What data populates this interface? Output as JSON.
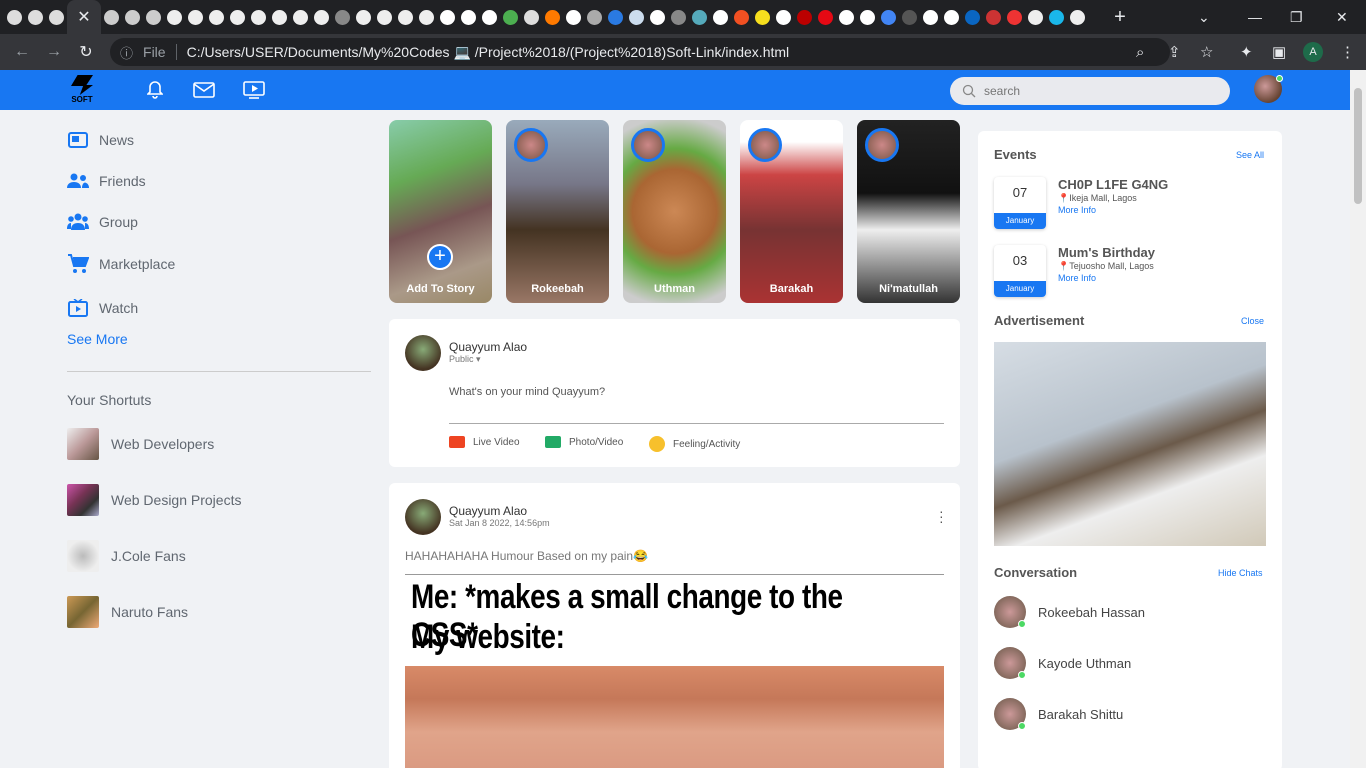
{
  "browser": {
    "url": "C:/Users/USER/Documents/My%20Codes 💻 /Project%2018/(Project%2018)Soft-Link/index.html",
    "file_label": "File",
    "profile_initial": "A"
  },
  "site": {
    "logo_text": "SOFT",
    "search_placeholder": "search"
  },
  "menu": {
    "items": [
      {
        "label": "News"
      },
      {
        "label": "Friends"
      },
      {
        "label": "Group"
      },
      {
        "label": "Marketplace"
      },
      {
        "label": "Watch"
      }
    ],
    "see_more": "See More"
  },
  "shortcuts": {
    "title": "Your Shortuts",
    "items": [
      {
        "label": "Web Developers"
      },
      {
        "label": "Web Design Projects"
      },
      {
        "label": "J.Cole Fans"
      },
      {
        "label": "Naruto Fans"
      }
    ]
  },
  "stories": [
    {
      "name": "Add To Story"
    },
    {
      "name": "Rokeebah"
    },
    {
      "name": "Uthman"
    },
    {
      "name": "Barakah"
    },
    {
      "name": "Ni'matullah"
    }
  ],
  "composer": {
    "user": "Quayyum Alao",
    "privacy": "Public",
    "prompt": "What's on your mind Quayyum?",
    "actions": [
      {
        "label": "Live Video"
      },
      {
        "label": "Photo/Video"
      },
      {
        "label": "Feeling/Activity"
      }
    ]
  },
  "post": {
    "user": "Quayyum Alao",
    "date": "Sat Jan 8 2022, 14:56pm",
    "caption": "HAHAHAHAHA Humour Based on my pain😂",
    "meme_line1": "Me: *makes a small change to the CSS*",
    "meme_line2": "My website:"
  },
  "events": {
    "title": "Events",
    "see_all": "See All",
    "items": [
      {
        "day": "07",
        "month": "January",
        "title": "CH0P L1FE G4NG",
        "location": "Ikeja Mall, Lagos",
        "more": "More Info"
      },
      {
        "day": "03",
        "month": "January",
        "title": "Mum's Birthday",
        "location": "Tejuosho Mall, Lagos",
        "more": "More Info"
      }
    ]
  },
  "ads": {
    "title": "Advertisement",
    "close": "Close"
  },
  "conversation": {
    "title": "Conversation",
    "hide": "Hide Chats",
    "items": [
      {
        "name": "Rokeebah Hassan"
      },
      {
        "name": "Kayode Uthman"
      },
      {
        "name": "Barakah Shittu"
      }
    ]
  }
}
